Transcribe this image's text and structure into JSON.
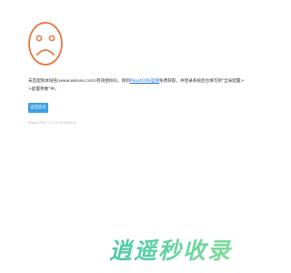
{
  "error": {
    "icon": "sad-face-icon",
    "accent_color": "#e8743b",
    "message_before_link": "未匹配到本域名(www.wikseo.com)有效授权码，请到",
    "link_text": "PbootCMS官网",
    "message_after_link": "免费获取，并登录系统后台填写到\"全局配置>>配置参数\"中。",
    "back_button_label": "返回首页",
    "version_text": "PbootCMS 3.2.12-20240502"
  },
  "watermark": {
    "text": "逍遥秒收录",
    "color": "#5fd3a8"
  }
}
